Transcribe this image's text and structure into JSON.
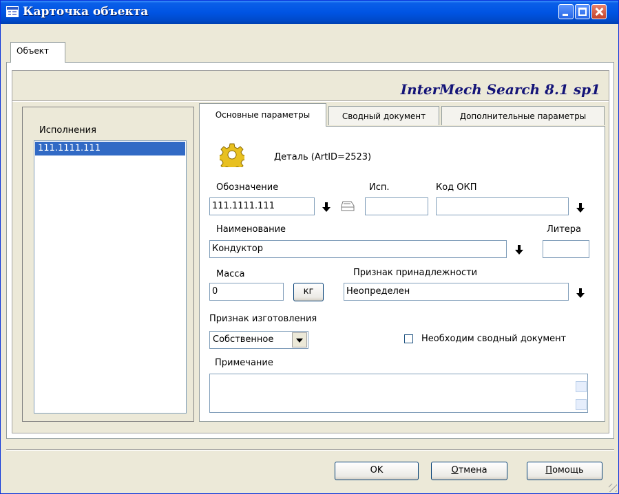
{
  "window": {
    "title": "Карточка объекта"
  },
  "outer_tab": {
    "label": "Объект"
  },
  "brand": "InterMech Search 8.1 sp1",
  "left": {
    "title": "Исполнения",
    "items": [
      "111.1111.111"
    ]
  },
  "tabs": [
    "Основные параметры",
    "Сводный документ",
    "Дополнительные параметры"
  ],
  "form": {
    "object_type": "Деталь (ArtID=2523)",
    "designation_label": "Обозначение",
    "designation_value": "111.1111.111",
    "isp_label": "Исп.",
    "isp_value": "",
    "okp_label": "Код ОКП",
    "okp_value": "",
    "name_label": "Наименование",
    "name_value": "Кондуктор",
    "litera_label": "Литера",
    "litera_value": "",
    "mass_label": "Масса",
    "mass_value": "0",
    "mass_unit": "кг",
    "belonging_label": "Признак принадлежности",
    "belonging_value": "Неопределен",
    "manufacture_label": "Признак изготовления",
    "manufacture_value": "Собственное",
    "summary_doc_label": "Необходим сводный документ",
    "note_label": "Примечание",
    "note_value": ""
  },
  "buttons": {
    "ok": "OK",
    "cancel_first": "О",
    "cancel_rest": "тмена",
    "help_first": "П",
    "help_rest": "омощь"
  },
  "colors": {
    "title_bar": "#0054e3",
    "selection": "#316ac5",
    "brand_text": "#141478",
    "gear": "#e8c020"
  }
}
